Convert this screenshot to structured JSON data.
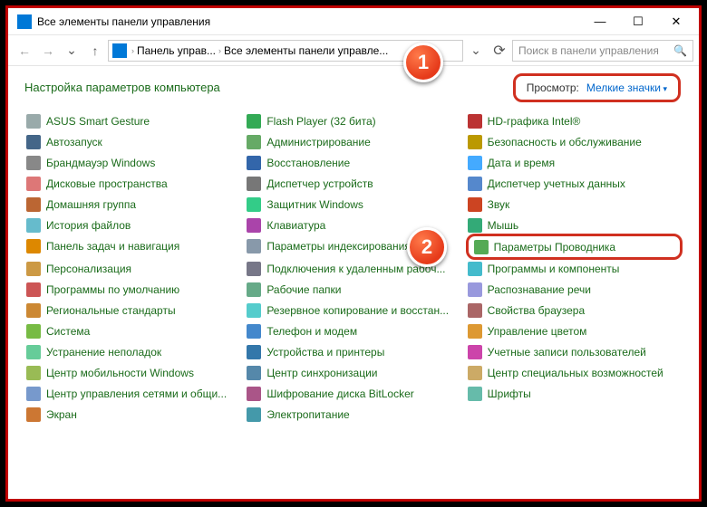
{
  "title": "Все элементы панели управления",
  "titlebar": {
    "min": "—",
    "max": "☐",
    "close": "✕"
  },
  "nav": {
    "crumbs": [
      "Панель управ...",
      "Все элементы панели управле..."
    ],
    "sep": "›",
    "dropdown": "⌄",
    "refresh": "⟳"
  },
  "search": {
    "placeholder": "Поиск в панели управления",
    "icon": "🔍"
  },
  "header": "Настройка параметров компьютера",
  "view": {
    "label": "Просмотр:",
    "value": "Мелкие значки"
  },
  "badges": {
    "one": "1",
    "two": "2"
  },
  "items": [
    "ASUS Smart Gesture",
    "Flash Player (32 бита)",
    "HD-графика Intel®",
    "Автозапуск",
    "Администрирование",
    "Безопасность и обслуживание",
    "Брандмауэр Windows",
    "Восстановление",
    "Дата и время",
    "Дисковые пространства",
    "Диспетчер устройств",
    "Диспетчер учетных данных",
    "Домашняя группа",
    "Защитник Windows",
    "Звук",
    "История файлов",
    "Клавиатура",
    "Мышь",
    "Панель задач и навигация",
    "Параметры индексирования",
    "Параметры Проводника",
    "Персонализация",
    "Подключения к удаленным рабоч...",
    "Программы и компоненты",
    "Программы по умолчанию",
    "Рабочие папки",
    "Распознавание речи",
    "Региональные стандарты",
    "Резервное копирование и восстан...",
    "Свойства браузера",
    "Система",
    "Телефон и модем",
    "Управление цветом",
    "Устранение неполадок",
    "Устройства и принтеры",
    "Учетные записи пользователей",
    "Центр мобильности Windows",
    "Центр синхронизации",
    "Центр специальных возможностей",
    "Центр управления сетями и общи...",
    "Шифрование диска BitLocker",
    "Шрифты",
    "Экран",
    "Электропитание"
  ]
}
